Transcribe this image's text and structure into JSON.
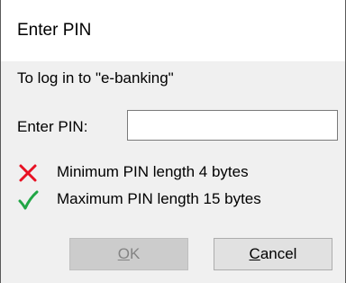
{
  "dialog": {
    "title": "Enter PIN",
    "subtitle": "To log in to \"e-banking\""
  },
  "pin_field": {
    "label": "Enter PIN:",
    "value": "",
    "placeholder": ""
  },
  "requirements": [
    {
      "status": "unmet",
      "icon": "cross-icon",
      "color": "#e81123",
      "text": "Minimum PIN length 4 bytes"
    },
    {
      "status": "met",
      "icon": "checkmark-icon",
      "color": "#21a645",
      "text": "Maximum PIN length 15 bytes"
    }
  ],
  "buttons": {
    "ok": {
      "mnemonic": "O",
      "rest": "K",
      "enabled": false
    },
    "cancel": {
      "mnemonic": "C",
      "rest": "ancel",
      "enabled": true
    }
  }
}
